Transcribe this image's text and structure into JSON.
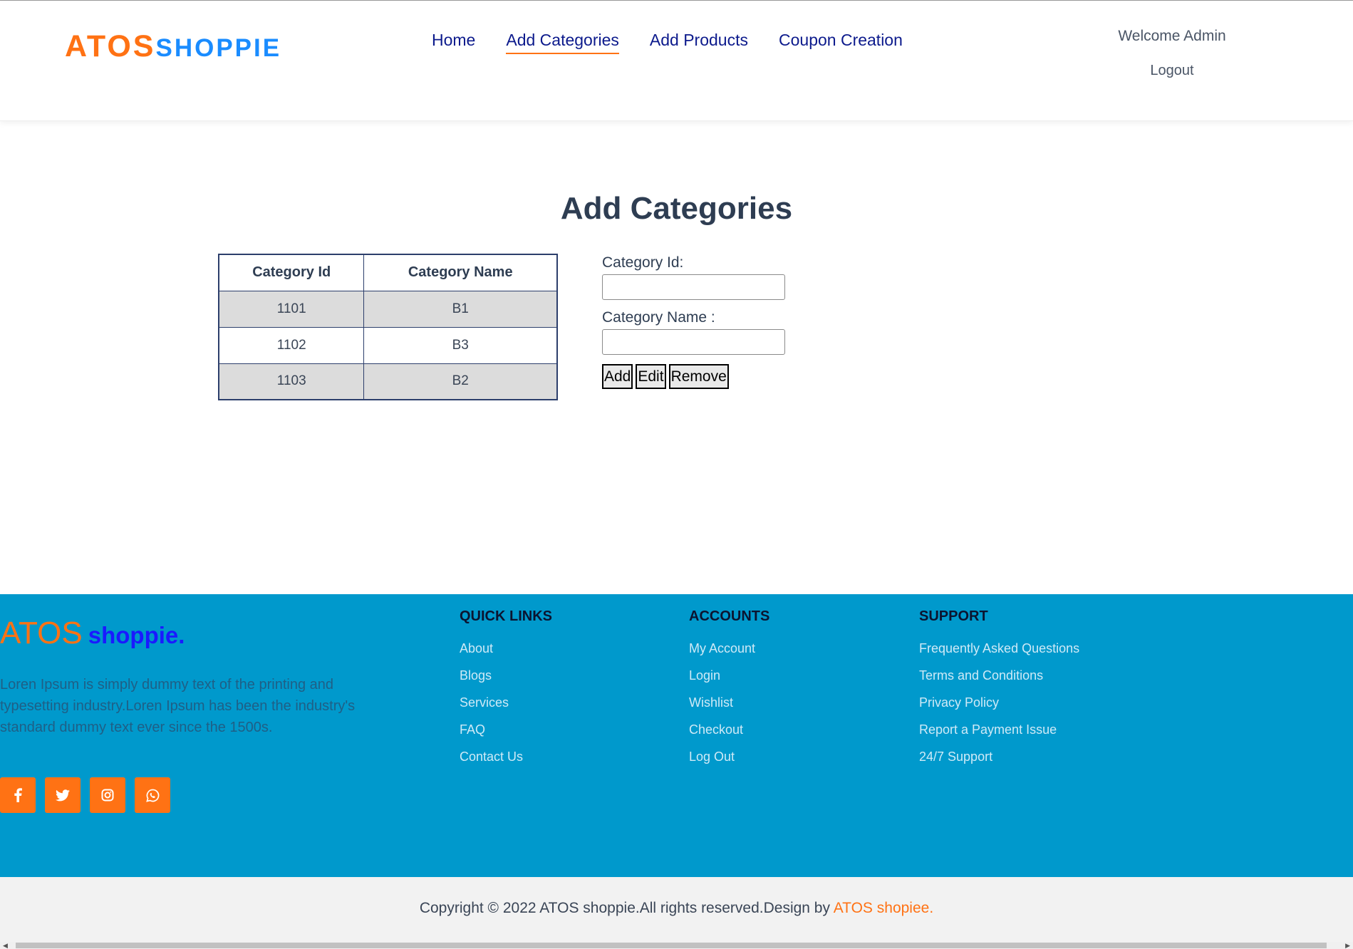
{
  "header": {
    "logo_part1": "ATOS",
    "logo_part2": "SHOPPIE",
    "nav": [
      {
        "label": "Home"
      },
      {
        "label": "Add Categories",
        "active": true
      },
      {
        "label": "Add Products"
      },
      {
        "label": "Coupon Creation"
      }
    ],
    "welcome": "Welcome Admin",
    "logout": "Logout"
  },
  "main": {
    "title": "Add Categories",
    "table": {
      "headers": [
        "Category Id",
        "Category Name"
      ],
      "rows": [
        [
          "1101",
          "B1"
        ],
        [
          "1102",
          "B3"
        ],
        [
          "1103",
          "B2"
        ]
      ]
    },
    "form": {
      "category_id_label": "Category Id:",
      "category_id_value": "",
      "category_name_label": "Category Name :",
      "category_name_value": "",
      "add_label": "Add",
      "edit_label": "Edit",
      "remove_label": "Remove"
    }
  },
  "footer": {
    "logo_part1": "ATOS",
    "logo_part2": "shoppie.",
    "description": "Loren Ipsum is simply dummy text of the printing and typesetting industry.Loren Ipsum has been the industry's standard dummy text ever since the 1500s.",
    "social_icons": [
      "facebook-icon",
      "twitter-icon",
      "instagram-icon",
      "whatsapp-icon"
    ],
    "quick_links": {
      "heading": "QUICK LINKS",
      "items": [
        "About",
        "Blogs",
        "Services",
        "FAQ",
        "Contact Us"
      ]
    },
    "accounts": {
      "heading": "ACCOUNTS",
      "items": [
        "My Account",
        "Login",
        "Wishlist",
        "Checkout",
        "Log Out"
      ]
    },
    "support": {
      "heading": "SUPPORT",
      "items": [
        "Frequently Asked Questions",
        "Terms and Conditions",
        "Privacy Policy",
        "Report a Payment Issue",
        "24/7 Support"
      ]
    },
    "copyright": "Copyright © 2022 ATOS shoppie.All rights reserved.Design by",
    "copyright_brand": "ATOS shopiee."
  },
  "colors": {
    "accent_orange": "#ff7214",
    "brand_blue": "#1a8cff",
    "nav_blue": "#0c1a8c",
    "footer_bg": "#0099cc"
  }
}
